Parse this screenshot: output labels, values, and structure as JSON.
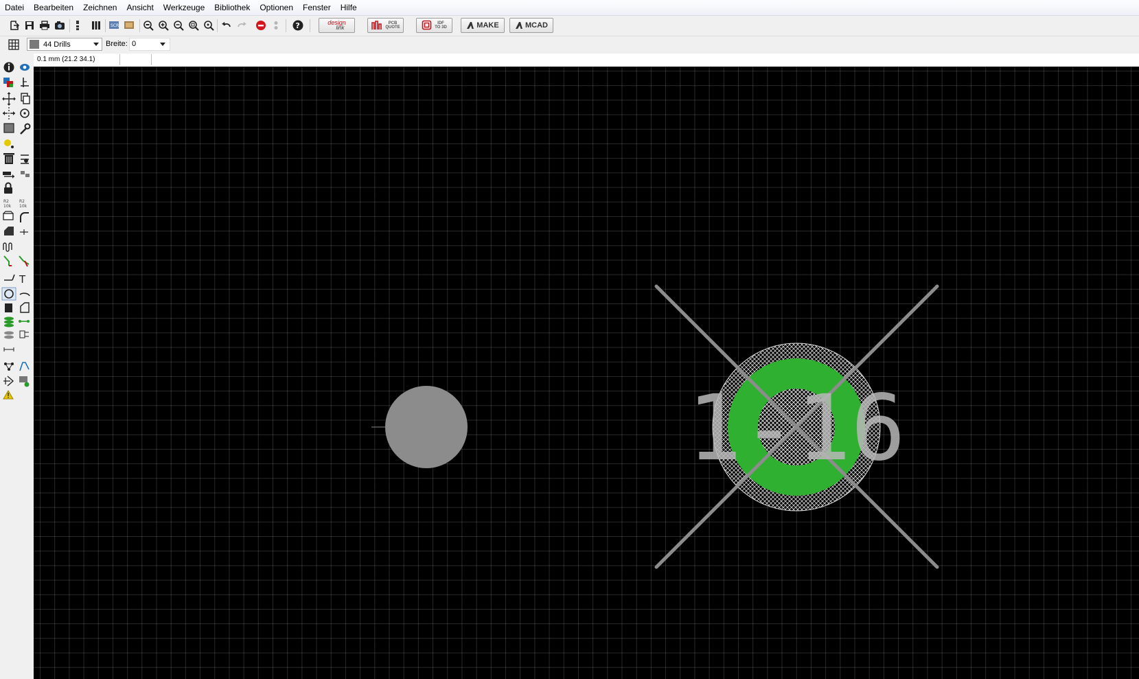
{
  "menu": {
    "items": [
      "Datei",
      "Bearbeiten",
      "Zeichnen",
      "Ansicht",
      "Werkzeuge",
      "Bibliothek",
      "Optionen",
      "Fenster",
      "Hilfe"
    ]
  },
  "toolbar": {
    "designlink_top": "design",
    "designlink_bottom": "link",
    "pcb_quote_top": "PCB",
    "pcb_quote_bottom": "QUOTE",
    "idf_top": "IDF",
    "idf_bottom": "TO 3D",
    "make_label": "MAKE",
    "mcad_label": "MCAD"
  },
  "params": {
    "layer_value": "44 Drills",
    "layer_color": "#7a7a7a",
    "width_label": "Breite:",
    "width_value": "0"
  },
  "status": {
    "coordinate": "0.1 mm (21.2 34.1)"
  },
  "canvas": {
    "background": "#000000",
    "pad_label": "1-16",
    "pad_color": "#30b030",
    "hole_color": "#8c8c8c",
    "cross_color": "#8c8c8c",
    "label_color": "#b8b8b8"
  },
  "icons": {
    "left_toolbar": [
      "info-icon",
      "show-icon",
      "display-layers-icon",
      "mark-icon",
      "move-icon",
      "copy-icon",
      "mirror-icon",
      "rotate-icon",
      "group-icon",
      "change-icon",
      "circle-dot-icon",
      "delete-icon",
      "add-icon",
      "replace-icon",
      "pinswap-icon",
      "lock-icon",
      "name-icon",
      "value-icon",
      "smash-icon",
      "miter-icon",
      "split-icon",
      "optimize-icon",
      "meander-icon",
      "route-icon",
      "ripup-icon",
      "wire-icon",
      "text-icon",
      "circle-icon",
      "arc-icon",
      "rect-icon",
      "polygon-icon",
      "via-icon",
      "signal-icon",
      "hole-icon",
      "attribute-icon",
      "dimension-icon",
      "ratsnest-icon",
      "autorouter-icon",
      "drc-icon",
      "erc-icon",
      "errors-icon"
    ]
  }
}
